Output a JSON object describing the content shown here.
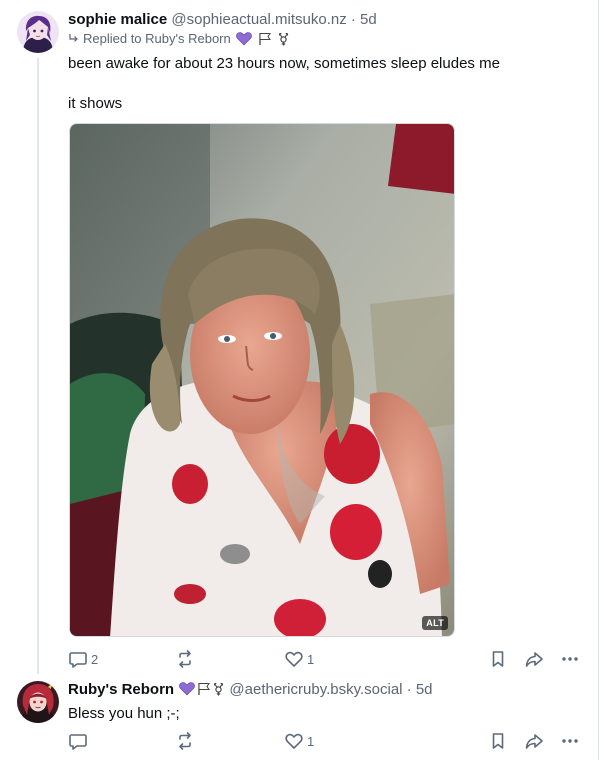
{
  "posts": [
    {
      "author": "sophie malice",
      "handle": "@sophieactual.mitsuko.nz",
      "separator": "·",
      "time": "5d",
      "reply_context": "Replied to Ruby's Reborn",
      "text_line1": "been awake for about 23 hours now, sometimes sleep eludes me",
      "text_line2": "it shows",
      "image_alt_badge": "ALT",
      "reply_count": "2",
      "repost_count": "",
      "like_count": "1"
    },
    {
      "author": "Ruby's Reborn",
      "handle": "@aethericruby.bsky.social",
      "separator": "·",
      "time": "5d",
      "text": "Bless you hun ;-;",
      "reply_count": "",
      "repost_count": "",
      "like_count": "1"
    }
  ],
  "icons": {
    "reply": "speech-bubble-icon",
    "repost": "repost-arrows-icon",
    "like": "heart-icon",
    "bookmark": "bookmark-icon",
    "share": "share-arrow-icon",
    "more": "more-dots-icon",
    "replied": "reply-arrow-icon"
  },
  "colors": {
    "purple_heart": "#8f6bd6",
    "meta_gray": "#5b6673",
    "action_gray": "#5b6a7a"
  }
}
